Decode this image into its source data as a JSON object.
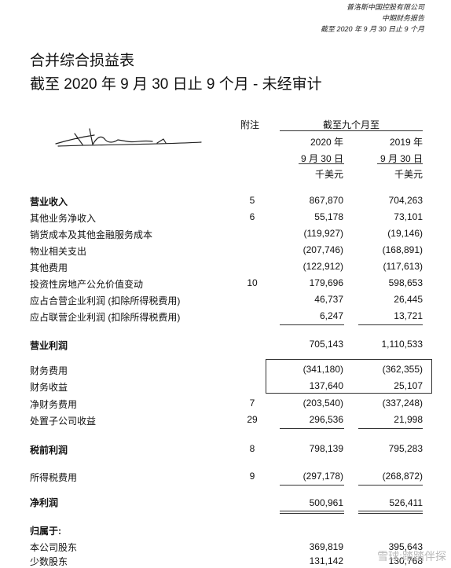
{
  "header": {
    "company": "普洛斯中国控股有限公司",
    "report": "中期财务报告",
    "date": "截至 2020 年 9 月 30 日止 9 个月"
  },
  "title": {
    "line1": "合并综合损益表",
    "line2": "截至 2020 年 9 月 30 日止 9 个月 - 未经审计"
  },
  "columns": {
    "note": "附注",
    "period": "截至九个月至",
    "y2020": "2020 年",
    "y2019": "2019 年",
    "d2020": "9 月 30 日",
    "d2019": "9 月 30 日",
    "u2020": "千美元",
    "u2019": "千美元"
  },
  "rows": [
    {
      "label": "营业收入",
      "note": "5",
      "v2020": "867,870",
      "v2019": "704,263"
    },
    {
      "label": "其他业务净收入",
      "note": "6",
      "v2020": "55,178",
      "v2019": "73,101"
    },
    {
      "label": "销货成本及其他金融服务成本",
      "note": "",
      "v2020": "(119,927)",
      "v2019": "(19,146)"
    },
    {
      "label": "物业相关支出",
      "note": "",
      "v2020": "(207,746)",
      "v2019": "(168,891)"
    },
    {
      "label": "其他费用",
      "note": "",
      "v2020": "(122,912)",
      "v2019": "(117,613)"
    },
    {
      "label": "投资性房地产公允价值变动",
      "note": "10",
      "v2020": "179,696",
      "v2019": "598,653"
    },
    {
      "label": "应占合营企业利润 (扣除所得税费用)",
      "note": "",
      "v2020": "46,737",
      "v2019": "26,445"
    },
    {
      "label": "应占联营企业利润 (扣除所得税费用)",
      "note": "",
      "v2020": "6,247",
      "v2019": "13,721"
    },
    {
      "label": "营业利润",
      "note": "",
      "v2020": "705,143",
      "v2019": "1,110,533"
    },
    {
      "label": "财务费用",
      "note": "",
      "v2020": "(341,180)",
      "v2019": "(362,355)"
    },
    {
      "label": "财务收益",
      "note": "",
      "v2020": "137,640",
      "v2019": "25,107"
    },
    {
      "label": "净财务费用",
      "note": "7",
      "v2020": "(203,540)",
      "v2019": "(337,248)"
    },
    {
      "label": "处置子公司收益",
      "note": "29",
      "v2020": "296,536",
      "v2019": "21,998"
    },
    {
      "label": "税前利润",
      "note": "8",
      "v2020": "798,139",
      "v2019": "795,283"
    },
    {
      "label": "所得税费用",
      "note": "9",
      "v2020": "(297,178)",
      "v2019": "(268,872)"
    },
    {
      "label": "净利润",
      "note": "",
      "v2020": "500,961",
      "v2019": "526,411"
    },
    {
      "label": "归属于:",
      "note": "",
      "v2020": "",
      "v2019": ""
    },
    {
      "label": "本公司股东",
      "note": "",
      "v2020": "369,819",
      "v2019": "395,643"
    },
    {
      "label": "少数股东",
      "note": "",
      "v2020": "131,142",
      "v2019": "130,768"
    }
  ],
  "watermark": "雪球:踏踏伴探"
}
